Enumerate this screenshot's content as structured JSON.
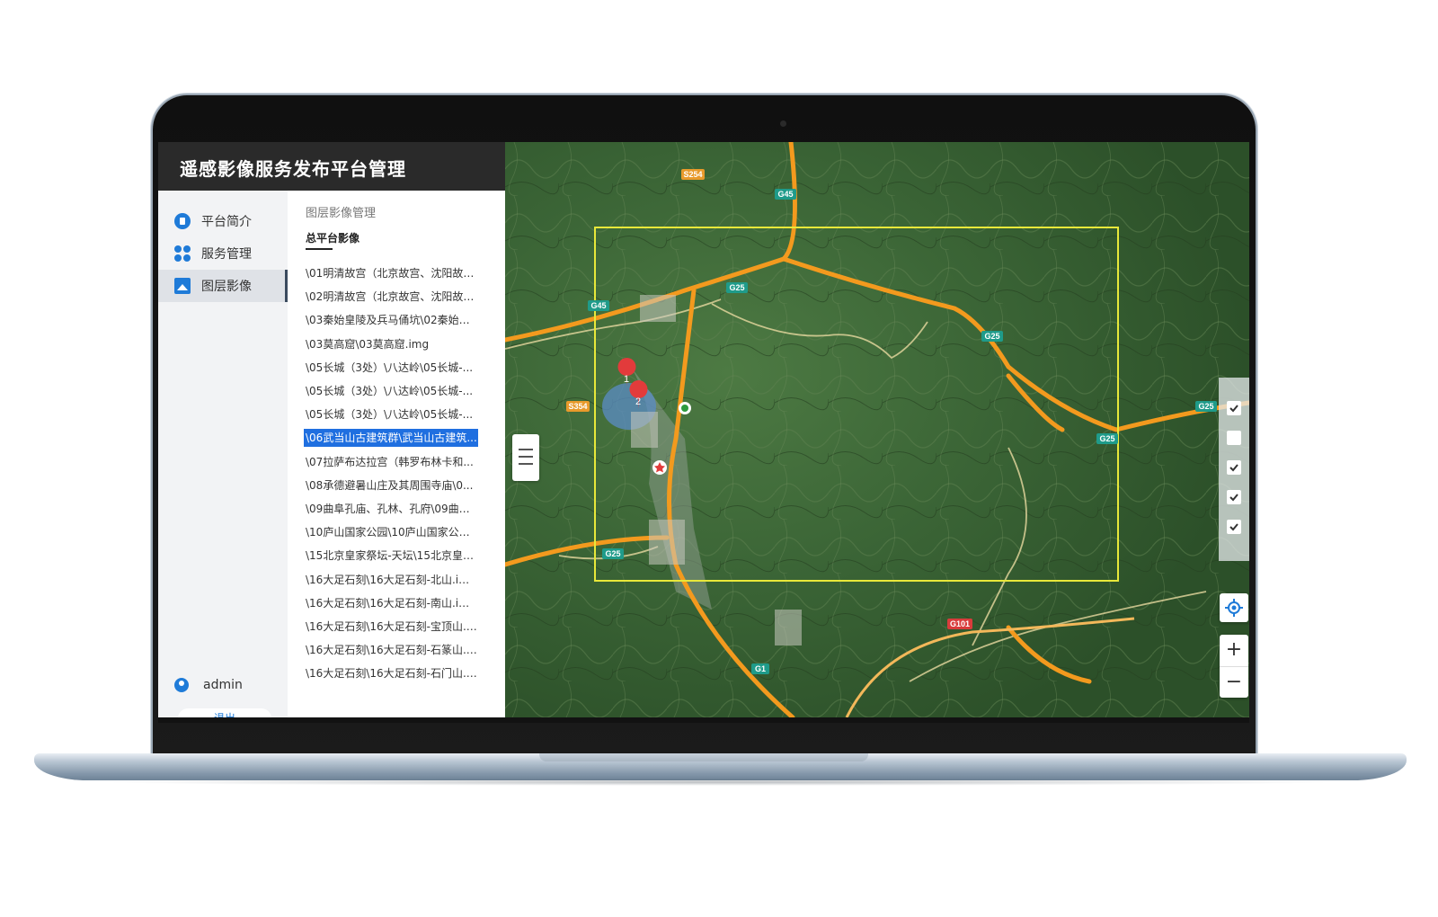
{
  "app": {
    "title": "遥感影像服务发布平台管理"
  },
  "sidebar": {
    "items": [
      {
        "label": "平台简介",
        "icon": "info-icon"
      },
      {
        "label": "服务管理",
        "icon": "services-icon"
      },
      {
        "label": "图层影像",
        "icon": "image-icon"
      }
    ],
    "active_index": 2,
    "user": {
      "name": "admin",
      "icon": "user-icon"
    },
    "logout_label": "退出"
  },
  "list": {
    "section_title": "图层影像管理",
    "tab_label": "总平台影像",
    "selected_index": 7,
    "items": [
      "\\01明清故宫（北京故宫、沈阳故宫...",
      "\\02明清故宫（北京故宫、沈阳故宫...",
      "\\03秦始皇陵及兵马俑坑\\02秦始皇...",
      "\\03莫高窟\\03莫高窟.img",
      "\\05长城（3处）\\八达岭\\05长城-...",
      "\\05长城（3处）\\八达岭\\05长城-...",
      "\\05长城（3处）\\八达岭\\05长城-...",
      "\\06武当山古建筑群\\武当山古建筑...",
      "\\07拉萨布达拉宫（韩罗布林卡和...",
      "\\08承德避暑山庄及其周围寺庙\\0...",
      "\\09曲阜孔庙、孔林、孔府\\09曲阜...",
      "\\10庐山国家公园\\10庐山国家公园...",
      "\\15北京皇家祭坛-天坛\\15北京皇家...",
      "\\16大足石刻\\16大足石刻-北山.img...",
      "\\16大足石刻\\16大足石刻-南山.img...",
      "\\16大足石刻\\16大足石刻-宝顶山.i...",
      "\\16大足石刻\\16大足石刻-石篆山.i...",
      "\\16大足石刻\\16大足石刻-石门山.i..."
    ]
  },
  "map": {
    "road_labels": [
      "S254",
      "G45",
      "G25",
      "G45",
      "G25",
      "G25",
      "S354",
      "G25",
      "G25",
      "G101",
      "G1"
    ],
    "markers": [
      "1",
      "2"
    ],
    "layer_toggles": [
      true,
      false,
      true,
      true,
      true
    ],
    "zoom_in_label": "+",
    "zoom_out_label": "−",
    "colors": {
      "highway": "#f39a1e",
      "selection": "#e8e83a",
      "terrain": "#3f6a3a",
      "marker": "#e23b3b"
    }
  }
}
